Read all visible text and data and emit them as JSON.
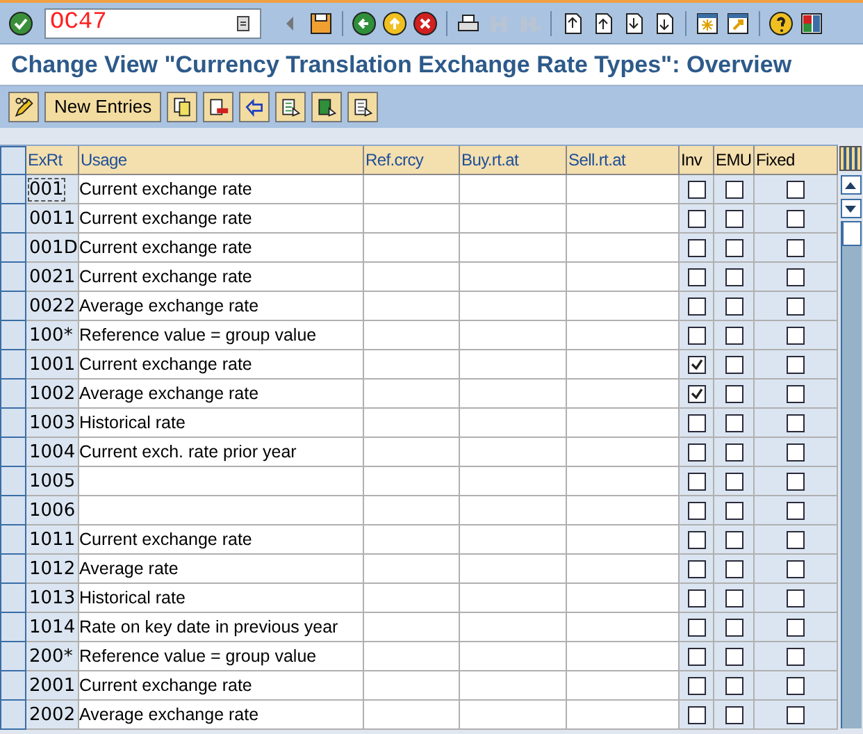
{
  "toolbar": {
    "command_field": {
      "value": "OC47"
    }
  },
  "title": "Change View \"Currency Translation Exchange Rate Types\": Overview",
  "app_toolbar": {
    "new_entries_button": "New Entries"
  },
  "table": {
    "columns": [
      "ExRt",
      "Usage",
      "Ref.crcy",
      "Buy.rt.at",
      "Sell.rt.at",
      "Inv",
      "EMU",
      "Fixed"
    ],
    "rows": [
      {
        "exrt": "001",
        "usage": "Current exchange rate",
        "focused": true,
        "inv": false,
        "emu": false,
        "fixed": false
      },
      {
        "exrt": "0011",
        "usage": "Current exchange rate",
        "focused": false,
        "inv": false,
        "emu": false,
        "fixed": false
      },
      {
        "exrt": "001D",
        "usage": "Current exchange rate",
        "focused": false,
        "inv": false,
        "emu": false,
        "fixed": false
      },
      {
        "exrt": "0021",
        "usage": "Current exchange rate",
        "focused": false,
        "inv": false,
        "emu": false,
        "fixed": false
      },
      {
        "exrt": "0022",
        "usage": "Average exchange rate",
        "focused": false,
        "inv": false,
        "emu": false,
        "fixed": false
      },
      {
        "exrt": "100*",
        "usage": "Reference value = group value",
        "focused": false,
        "inv": false,
        "emu": false,
        "fixed": false
      },
      {
        "exrt": "1001",
        "usage": "Current exchange rate",
        "focused": false,
        "inv": true,
        "emu": false,
        "fixed": false
      },
      {
        "exrt": "1002",
        "usage": "Average exchange rate",
        "focused": false,
        "inv": true,
        "emu": false,
        "fixed": false
      },
      {
        "exrt": "1003",
        "usage": "Historical rate",
        "focused": false,
        "inv": false,
        "emu": false,
        "fixed": false
      },
      {
        "exrt": "1004",
        "usage": "Current exch. rate prior year",
        "focused": false,
        "inv": false,
        "emu": false,
        "fixed": false
      },
      {
        "exrt": "1005",
        "focused": false,
        "inv": false,
        "emu": false,
        "fixed": false
      },
      {
        "exrt": "1006",
        "focused": false,
        "inv": false,
        "emu": false,
        "fixed": false
      },
      {
        "exrt": "1011",
        "usage": "Current exchange rate",
        "focused": false,
        "inv": false,
        "emu": false,
        "fixed": false
      },
      {
        "exrt": "1012",
        "usage": "Average rate",
        "focused": false,
        "inv": false,
        "emu": false,
        "fixed": false
      },
      {
        "exrt": "1013",
        "usage": "Historical rate",
        "focused": false,
        "inv": false,
        "emu": false,
        "fixed": false
      },
      {
        "exrt": "1014",
        "usage": "Rate on key date in previous year",
        "focused": false,
        "inv": false,
        "emu": false,
        "fixed": false
      },
      {
        "exrt": "200*",
        "usage": "Reference value = group value",
        "focused": false,
        "inv": false,
        "emu": false,
        "fixed": false
      },
      {
        "exrt": "2001",
        "usage": "Current exchange rate",
        "focused": false,
        "inv": false,
        "emu": false,
        "fixed": false
      },
      {
        "exrt": "2002",
        "usage": "Average exchange rate",
        "focused": false,
        "inv": false,
        "emu": false,
        "fixed": false
      }
    ]
  }
}
